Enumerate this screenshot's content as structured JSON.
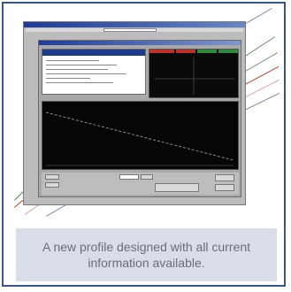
{
  "caption": {
    "text": "A new profile designed with all current information available."
  },
  "colors": {
    "frame_border": "#3a5689",
    "caption_background": "#d9dde8",
    "caption_text": "#6a6e78",
    "callout_lines": [
      "#5a7a5a",
      "#b0463a",
      "#d8a8a0",
      "#7a8aa8"
    ]
  },
  "screenshot": {
    "description_icon": "software-profile-screenshot"
  }
}
